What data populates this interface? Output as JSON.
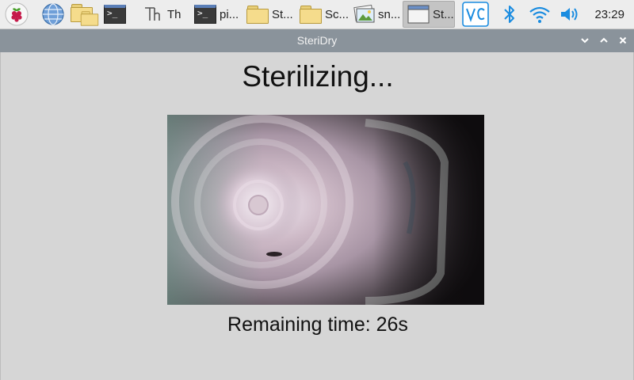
{
  "taskbar": {
    "launchers": [
      {
        "name": "raspberry-menu-icon"
      },
      {
        "name": "web-browser-icon"
      },
      {
        "name": "file-manager-icon"
      },
      {
        "name": "terminal-icon"
      }
    ],
    "tasks": [
      {
        "icon": "thonny-icon",
        "label": "Th"
      },
      {
        "icon": "terminal-icon",
        "label": "pi..."
      },
      {
        "icon": "folder-icon",
        "label": "St..."
      },
      {
        "icon": "folder-icon",
        "label": "Sc..."
      },
      {
        "icon": "image-viewer-icon",
        "label": "sn..."
      },
      {
        "icon": "window-icon",
        "label": "St...",
        "active": true
      }
    ],
    "tray": [
      "vnc-icon",
      "bluetooth-icon",
      "wifi-icon",
      "volume-icon"
    ],
    "clock": "23:29"
  },
  "window": {
    "title": "SteriDry",
    "controls": [
      "minimize",
      "maximize",
      "close"
    ]
  },
  "main": {
    "heading": "Sterilizing...",
    "remaining_text": "Remaining time: 26s"
  },
  "colors": {
    "titlebar": "#8a939b",
    "background": "#d6d6d6",
    "accent_blue": "#1a8ce0"
  }
}
